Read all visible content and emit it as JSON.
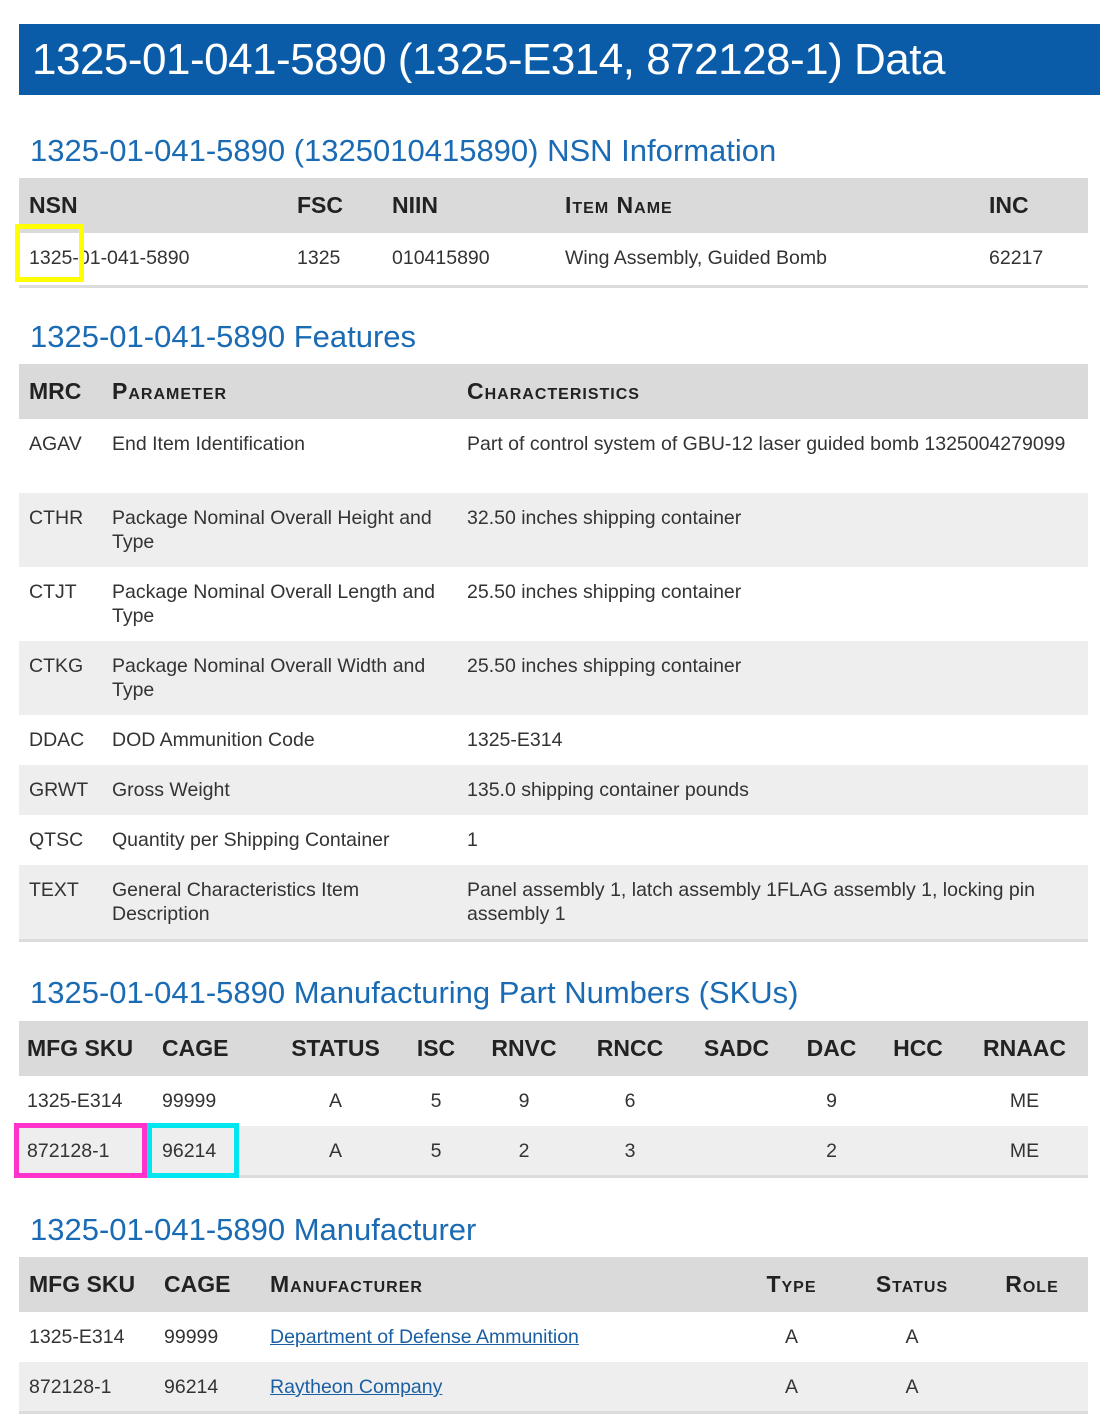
{
  "banner": {
    "title": "1325-01-041-5890 (1325-E314, 872128-1) Data"
  },
  "nsn_section": {
    "heading": "1325-01-041-5890 (1325010415890) NSN Information",
    "headers": {
      "nsn": "NSN",
      "fsc": "FSC",
      "niin": "NIIN",
      "item_name": "Item Name",
      "inc": "INC"
    },
    "row": {
      "nsn": "1325-01-041-5890",
      "fsc": "1325",
      "niin": "010415890",
      "item_name": "Wing Assembly, Guided Bomb",
      "inc": "62217"
    }
  },
  "features_section": {
    "heading": "1325-01-041-5890 Features",
    "headers": {
      "mrc": "MRC",
      "parameter": "Parameter",
      "characteristics": "Characteristics"
    },
    "rows": [
      {
        "mrc": "AGAV",
        "parameter": "End Item Identification",
        "characteristics": "Part of control system of GBU-12 laser guided bomb 1325004279099"
      },
      {
        "mrc": "CTHR",
        "parameter": "Package Nominal Overall Height and Type",
        "characteristics": "32.50 inches shipping container"
      },
      {
        "mrc": "CTJT",
        "parameter": "Package Nominal Overall Length and Type",
        "characteristics": "25.50 inches shipping container"
      },
      {
        "mrc": "CTKG",
        "parameter": "Package Nominal Overall Width and Type",
        "characteristics": "25.50 inches shipping container"
      },
      {
        "mrc": "DDAC",
        "parameter": "DOD Ammunition Code",
        "characteristics": "1325-E314"
      },
      {
        "mrc": "GRWT",
        "parameter": "Gross Weight",
        "characteristics": "135.0 shipping container pounds"
      },
      {
        "mrc": "QTSC",
        "parameter": "Quantity per Shipping Container",
        "characteristics": "1"
      },
      {
        "mrc": "TEXT",
        "parameter": "General Characteristics Item Description",
        "characteristics": "Panel assembly 1, latch assembly 1FLAG assembly 1, locking pin assembly 1"
      }
    ]
  },
  "skus_section": {
    "heading": "1325-01-041-5890 Manufacturing Part Numbers (SKUs)",
    "headers": {
      "mfg_sku": "MFG SKU",
      "cage": "CAGE",
      "status": "STATUS",
      "isc": "ISC",
      "rnvc": "RNVC",
      "rncc": "RNCC",
      "sadc": "SADC",
      "dac": "DAC",
      "hcc": "HCC",
      "rnaac": "RNAAC"
    },
    "rows": [
      {
        "mfg_sku": "1325-E314",
        "cage": "99999",
        "status": "A",
        "isc": "5",
        "rnvc": "9",
        "rncc": "6",
        "sadc": "",
        "dac": "9",
        "hcc": "",
        "rnaac": "ME"
      },
      {
        "mfg_sku": "872128-1",
        "cage": "96214",
        "status": "A",
        "isc": "5",
        "rnvc": "2",
        "rncc": "3",
        "sadc": "",
        "dac": "2",
        "hcc": "",
        "rnaac": "ME"
      }
    ]
  },
  "manufacturer_section": {
    "heading": "1325-01-041-5890 Manufacturer",
    "headers": {
      "mfg_sku": "MFG SKU",
      "cage": "CAGE",
      "manufacturer": "Manufacturer",
      "type": "Type",
      "status": "Status",
      "role": "Role"
    },
    "rows": [
      {
        "mfg_sku": "1325-E314",
        "cage": "99999",
        "manufacturer": "Department of Defense Ammunition",
        "type": "A",
        "status": "A",
        "role": ""
      },
      {
        "mfg_sku": "872128-1",
        "cage": "96214",
        "manufacturer": "Raytheon Company",
        "type": "A",
        "status": "A",
        "role": ""
      }
    ]
  },
  "colors": {
    "banner": "#0a5ba8",
    "heading": "#1a6bb3",
    "highlight_yellow": "#ffff00",
    "highlight_pink": "#ff33cc",
    "highlight_cyan": "#00e5f0"
  }
}
